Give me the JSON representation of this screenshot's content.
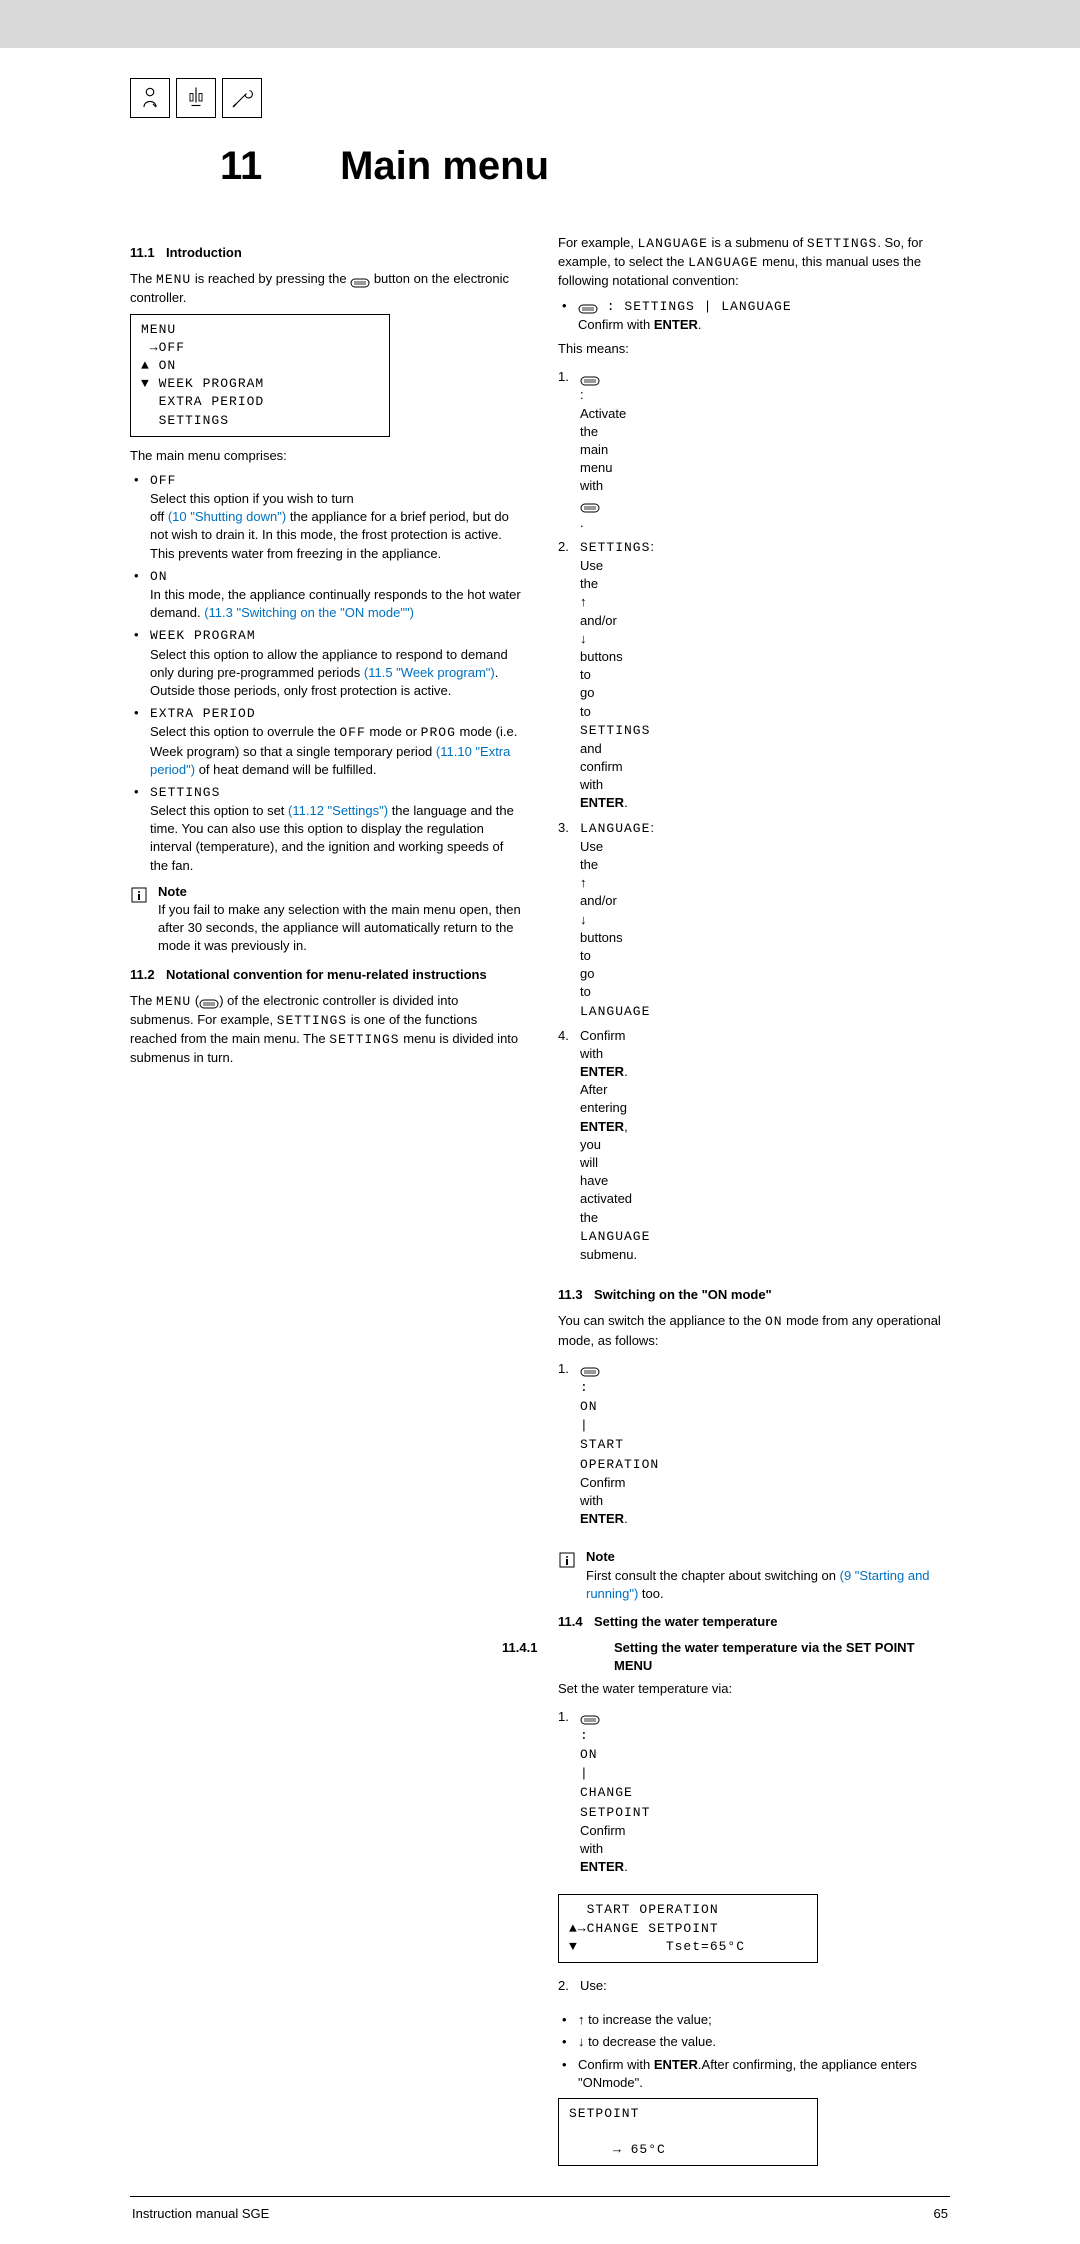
{
  "chapter": {
    "number": "11",
    "title": "Main menu"
  },
  "s11_1": {
    "heading_num": "11.1",
    "heading": "Introduction",
    "intro_pre": "The ",
    "intro_menu": "MENU",
    "intro_mid": " is reached by pressing the ",
    "intro_post": " button on the electronic controller.",
    "display": "MENU\n →OFF\n▲ ON\n▼ WEEK PROGRAM\n  EXTRA PERIOD\n  SETTINGS",
    "comprises": "The main menu comprises:",
    "off": {
      "label": "OFF",
      "t1": "Select this option if you wish to turn",
      "t2_pre": "off ",
      "t2_link": "(10 \"Shutting down\")",
      "t2_post": " the appliance for a brief period, but do not wish to drain it. In this mode, the frost protection is active. This prevents water from freezing in the appliance."
    },
    "on": {
      "label": "ON",
      "t1": "In this mode, the appliance continually responds to the hot water demand. ",
      "t1_link": "(11.3 \"Switching on the \"ON mode\"\")"
    },
    "week": {
      "label": "WEEK PROGRAM",
      "t1": "Select this option to allow the appliance to respond to demand only during pre-programmed periods ",
      "t1_link": "(11.5 \"Week program\")",
      "t1_post": ". Outside those periods, only frost protection is active."
    },
    "extra": {
      "label": "EXTRA PERIOD",
      "t1_pre": "Select this option to overrule the ",
      "t1_off": "OFF",
      "t1_mid": " mode or ",
      "t1_prog": "PROG",
      "t1_mid2": " mode (i.e. Week program) so that a single temporary period ",
      "t1_link": "(11.10 \"Extra period\")",
      "t1_post": " of heat demand will be fulfilled."
    },
    "settings": {
      "label": "SETTINGS",
      "t1_pre": "Select this option to set ",
      "t1_link": "(11.12 \"Settings\")",
      "t1_post": " the language and the time. You can also use this option to display the regulation interval (temperature), and the ignition and working speeds of the fan."
    },
    "note_title": "Note",
    "note_body": "If you fail to make any selection with the main menu open, then after 30 seconds, the appliance will automatically return to the mode it was previously in."
  },
  "s11_2": {
    "heading_num": "11.2",
    "heading": "Notational convention for menu-related instructions",
    "p1_pre": "The ",
    "p1_menu": "MENU",
    "p1_mid": " (",
    "p1_mid2": ") of the electronic controller is divided into submenus. For example, ",
    "p1_settings": "SETTINGS",
    "p1_post": " is one of the functions reached from the main menu. The ",
    "p1_settings2": "SETTINGS",
    "p1_end": " menu is divided into submenus in turn."
  },
  "right": {
    "p1_pre": "For example, ",
    "p1_lang": "LANGUAGE",
    "p1_mid": " is a submenu of ",
    "p1_set": "SETTINGS",
    "p1_mid2": ". So, for example, to select the ",
    "p1_lang2": "LANGUAGE",
    "p1_post": " menu, this manual uses the following notational convention:",
    "conv1": " : SETTINGS | LANGUAGE",
    "conv2_pre": "Confirm with ",
    "conv2_enter": "ENTER",
    "conv2_post": ".",
    "means": "This means:",
    "step1_pre": " : Activate the main menu with ",
    "step2_pre": "SETTINGS",
    "step2_mid": ": Use the ",
    "step2_up": "↑",
    "step2_and": " and/or ",
    "step2_down": "↓",
    "step2_post": " buttons to go to ",
    "step2_set": "SETTINGS",
    "step2_end": " and confirm with ",
    "step2_enter": "ENTER",
    "step2_dot": ".",
    "step3_lang": "LANGUAGE",
    "step3_mid": ": Use the ",
    "step3_post": " buttons to go to ",
    "step3_lang2": "LANGUAGE",
    "step4_pre": "Confirm with ",
    "step4_enter": "ENTER",
    "step4_mid": ". After entering ",
    "step4_enter2": "ENTER",
    "step4_mid2": ", you will have activated the ",
    "step4_lang": "LANGUAGE",
    "step4_post": " submenu."
  },
  "s11_3": {
    "heading_num": "11.3",
    "heading": "Switching on the \"ON mode\"",
    "p1_pre": "You can switch the appliance to the ",
    "p1_on": "ON",
    "p1_post": " mode from any operational mode, as follows:",
    "step1": " : ON | START OPERATION",
    "conf_pre": "Confirm with ",
    "conf_enter": "ENTER",
    "conf_post": ".",
    "note_title": "Note",
    "note_body_pre": "First consult the chapter about switching on ",
    "note_link": "(9 \"Starting and running\")",
    "note_body_post": " too."
  },
  "s11_4": {
    "heading_num": "11.4",
    "heading": "Setting the water temperature",
    "sub_num": "11.4.1",
    "sub_heading": "Setting the water temperature via the SET POINT MENU",
    "set_intro": "Set the water temperature via:",
    "step1": ": ON | CHANGE SETPOINT",
    "conf_pre": "Confirm with ",
    "conf_enter": "ENTER",
    "conf_post": ".",
    "display1": "  START OPERATION\n▲→CHANGE SETPOINT\n▼          Tset=65°C",
    "use": "Use:",
    "inc_pre": "↑",
    "inc": " to increase the value;",
    "dec_pre": "↓",
    "dec": " to decrease the value.",
    "conf2_pre": "Confirm with ",
    "conf2_enter": "ENTER",
    "conf2_mid": ".After confirming, the appliance enters \"ONmode\".",
    "display2": "SETPOINT\n\n     → 65°C"
  },
  "footer": {
    "left": "Instruction manual SGE",
    "right": "65"
  }
}
